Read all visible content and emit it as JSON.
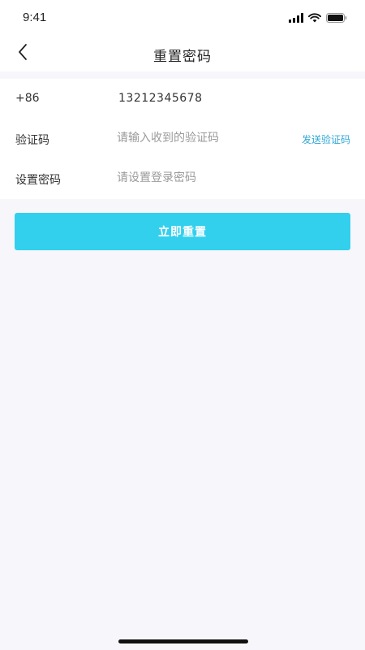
{
  "status_bar": {
    "time": "9:41",
    "icons": [
      "signal-icon",
      "wifi-icon",
      "battery-icon"
    ]
  },
  "nav": {
    "title": "重置密码",
    "back_icon": "chevron-left-icon"
  },
  "form": {
    "phone": {
      "prefix": "+86",
      "value": "13212345678"
    },
    "code": {
      "label": "验证码",
      "placeholder": "请输入收到的验证码",
      "send_label": "发送验证码"
    },
    "password": {
      "label": "设置密码",
      "placeholder": "请设置登录密码"
    }
  },
  "submit_label": "立即重置",
  "colors": {
    "accent": "#33d0ee",
    "link": "#2fa7d6",
    "background": "#f7f6fa"
  }
}
